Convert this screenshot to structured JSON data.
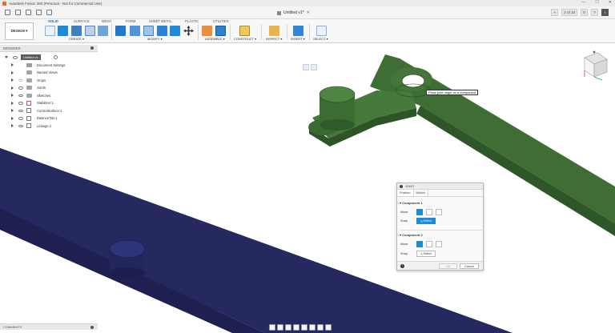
{
  "window": {
    "title": "Autodesk Fusion 360 (Personal - Not for Commercial Use)",
    "controls": [
      "—",
      "☐",
      "✕"
    ]
  },
  "doc_tab": {
    "label": "Untitled v1*",
    "close": "✕"
  },
  "right_bar": {
    "add": "+",
    "jobs": "2 of 10",
    "notif": "0",
    "help": "?",
    "user": "I"
  },
  "ribbon": {
    "design_label": "DESIGN ▾",
    "tabs": [
      "SOLID",
      "SURFACE",
      "MESH",
      "FORM",
      "SHEET METAL",
      "PLASTIC",
      "UTILITIES"
    ],
    "active_tab": "SOLID",
    "groups": [
      "CREATE ▾",
      "MODIFY ▾",
      "ASSEMBLE ▾",
      "CONSTRUCT ▾",
      "INSPECT ▾",
      "INSERT ▾",
      "SELECT ▾"
    ]
  },
  "browser": {
    "header": "BROWSER",
    "root": "Untitled v1",
    "items": [
      {
        "label": "Document Settings",
        "kind": "settings"
      },
      {
        "label": "Named Views",
        "kind": "folder"
      },
      {
        "label": "Origin",
        "kind": "folder"
      },
      {
        "label": "Joints",
        "kind": "folder"
      },
      {
        "label": "Sketches",
        "kind": "folder"
      },
      {
        "label": "Stabilizer:1",
        "kind": "component"
      },
      {
        "label": "ControlSurface:1",
        "kind": "component"
      },
      {
        "label": "BalanceTab:1",
        "kind": "component"
      },
      {
        "label": "Linkage:1",
        "kind": "component"
      }
    ]
  },
  "comments": {
    "label": "COMMENTS"
  },
  "tooltip": "Place joint origin on a component",
  "joint_dialog": {
    "title": "JOINT",
    "tabs": [
      "Position",
      "Motion"
    ],
    "component1": {
      "label": "Component 1",
      "mode": "Mode",
      "snap": "Snap",
      "select": "Select"
    },
    "component2": {
      "label": "Component 2",
      "mode": "Mode",
      "snap": "Snap",
      "select": "Select"
    },
    "ok": "OK",
    "cancel": "Cancel"
  },
  "colors": {
    "green_part": "#3d6b34",
    "navy_part": "#2b2e66",
    "accent": "#1f8ad8"
  }
}
